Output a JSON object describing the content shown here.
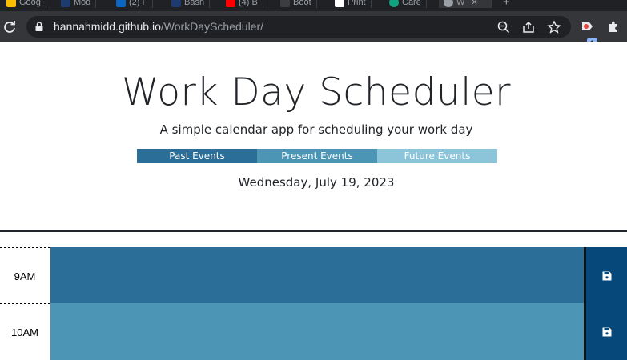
{
  "browser": {
    "tabs": [
      {
        "title": "Goog",
        "favicon": "google-icon",
        "color": "#fbbc04"
      },
      {
        "title": "Mod",
        "favicon": "bootstrap-icon",
        "color": "#1d3b6f"
      },
      {
        "title": "(2) F",
        "favicon": "linkedin-icon",
        "color": "#0a66c2"
      },
      {
        "title": "Bash",
        "favicon": "bash-icon",
        "color": "#1d3b6f"
      },
      {
        "title": "(4) B",
        "favicon": "youtube-icon",
        "color": "#ff0000"
      },
      {
        "title": "Boot",
        "favicon": "bootstrap-icon",
        "color": "#3c3d41"
      },
      {
        "title": "Print",
        "favicon": "notion-icon",
        "color": "#ffffff"
      },
      {
        "title": "Care",
        "favicon": "chatgpt-icon",
        "color": "#10a37f"
      },
      {
        "title": "W",
        "favicon": "globe-icon",
        "color": "#9aa0a6"
      }
    ],
    "url_host": "hannahmidd.github.io",
    "url_path": "/WorkDayScheduler/",
    "extension_badge": "1"
  },
  "header": {
    "title": "Work Day Scheduler",
    "subtitle": "A simple calendar app for scheduling your work day",
    "legend": {
      "past": "Past Events",
      "present": "Present Events",
      "future": "Future Events"
    },
    "current_date": "Wednesday, July 19, 2023"
  },
  "colors": {
    "past": "#2b6e97",
    "present": "#4c95b5",
    "future": "#8cc4d9",
    "save": "#06487a"
  },
  "schedule": {
    "rows": [
      {
        "hour": "9AM",
        "status": "past",
        "text": ""
      },
      {
        "hour": "10AM",
        "status": "present",
        "text": ""
      }
    ],
    "save_icon": "floppy-disk-icon"
  }
}
